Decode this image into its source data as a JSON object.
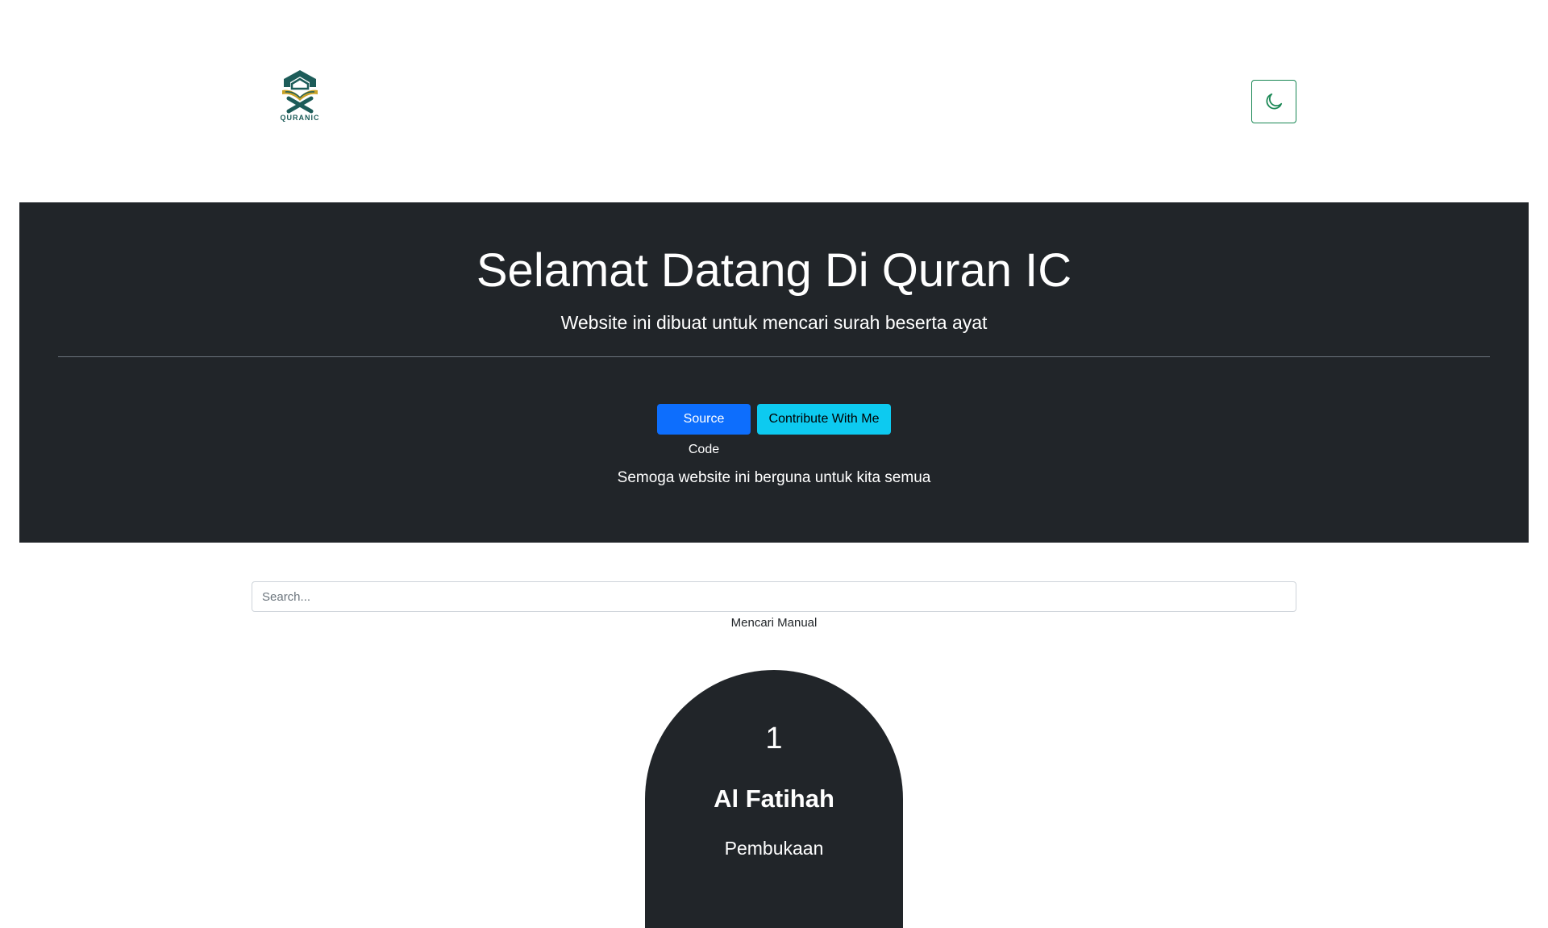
{
  "navbar": {
    "logo_text": "QURANIC",
    "theme_toggle_icon": "moon-icon",
    "accent_color": "#198754"
  },
  "hero": {
    "title": "Selamat Datang Di Quran IC",
    "lead": "Website ini dibuat untuk mencari surah beserta ayat",
    "buttons": {
      "source_code": "Source Code",
      "contribute": "Contribute With Me"
    },
    "note": "Semoga website ini berguna untuk kita semua",
    "background_color": "#212529"
  },
  "search": {
    "placeholder": "Search...",
    "value": "",
    "help_text": "Mencari Manual"
  },
  "surah_list": [
    {
      "number": "1",
      "name": "Al Fatihah",
      "meaning": "Pembukaan"
    }
  ]
}
